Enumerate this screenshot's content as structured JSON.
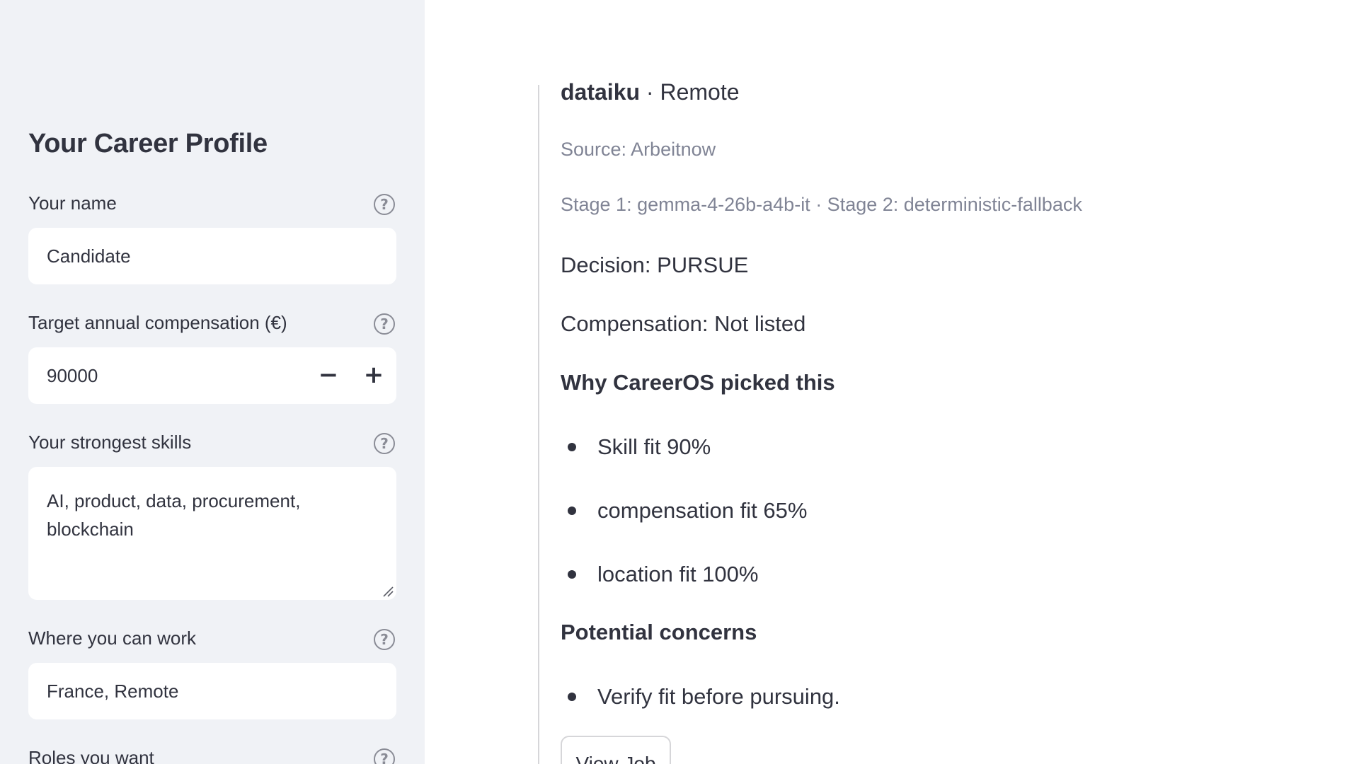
{
  "sidebar": {
    "title": "Your Career Profile",
    "name": {
      "label": "Your name",
      "value": "Candidate"
    },
    "compensation": {
      "label": "Target annual compensation (€)",
      "value": "90000",
      "minus": "−",
      "plus": "+"
    },
    "skills": {
      "label": "Your strongest skills",
      "value": "AI, product, data, procurement, blockchain"
    },
    "location": {
      "label": "Where you can work",
      "value": "France, Remote"
    },
    "roles": {
      "label": "Roles you want"
    },
    "help_glyph": "?"
  },
  "job": {
    "company": "dataiku",
    "location_suffix": " · Remote",
    "source": "Source: Arbeitnow",
    "stages": "Stage 1: gemma-4-26b-a4b-it · Stage 2: deterministic-fallback",
    "decision": "Decision: PURSUE",
    "compensation": "Compensation: Not listed",
    "why_heading": "Why CareerOS picked this",
    "why_items": [
      "Skill fit 90%",
      "compensation fit 65%",
      "location fit 100%"
    ],
    "concerns_heading": "Potential concerns",
    "concerns_items": [
      "Verify fit before pursuing."
    ],
    "view_button": "View Job"
  }
}
